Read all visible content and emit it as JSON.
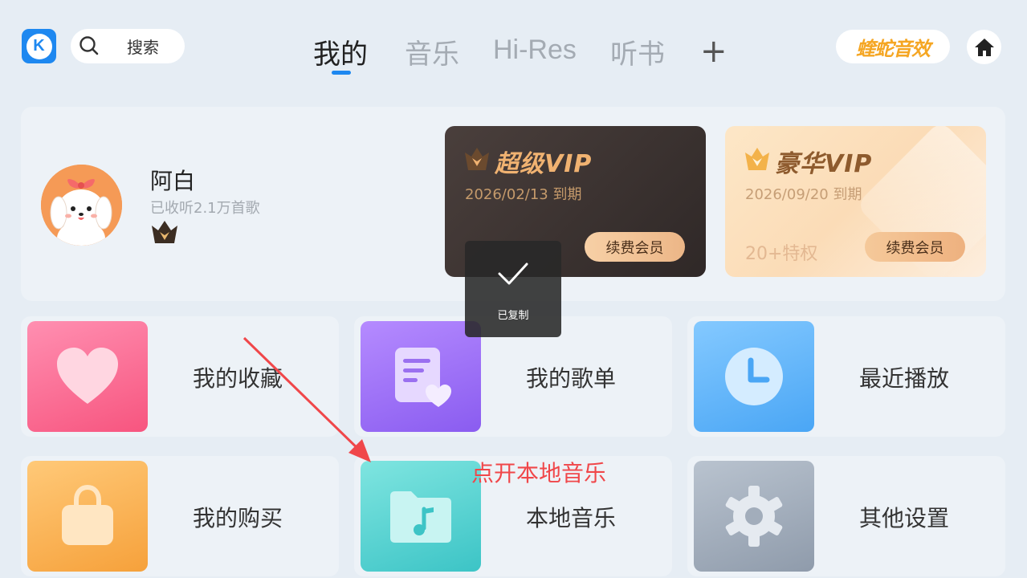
{
  "header": {
    "logo_letter": "K",
    "search": {
      "label": "搜索"
    },
    "tabs": [
      {
        "label": "我的",
        "active": true
      },
      {
        "label": "音乐",
        "active": false
      },
      {
        "label": "Hi-Res",
        "active": false
      },
      {
        "label": "听书",
        "active": false
      }
    ],
    "add_tab": "+",
    "effect_badge": "蝰蛇音效",
    "accent_color": "#1e88f0"
  },
  "profile": {
    "name": "阿白",
    "listen_count": "已收听2.1万首歌"
  },
  "vip_cards": [
    {
      "title": "超级VIP",
      "expire": "2026/02/13 到期",
      "perks": "",
      "button": "续费会员"
    },
    {
      "title": "豪华VIP",
      "expire": "2026/09/20 到期",
      "perks": "20+特权",
      "button": "续费会员"
    }
  ],
  "tiles": [
    {
      "label": "我的收藏",
      "icon": "heart-icon"
    },
    {
      "label": "我的歌单",
      "icon": "playlist-icon"
    },
    {
      "label": "最近播放",
      "icon": "clock-icon"
    },
    {
      "label": "我的购买",
      "icon": "shopping-bag-icon"
    },
    {
      "label": "本地音乐",
      "icon": "music-folder-icon"
    },
    {
      "label": "其他设置",
      "icon": "gear-icon"
    }
  ],
  "toast": {
    "message": "已复制"
  },
  "annotation": {
    "text": "点开本地音乐",
    "color": "#f0474a"
  }
}
